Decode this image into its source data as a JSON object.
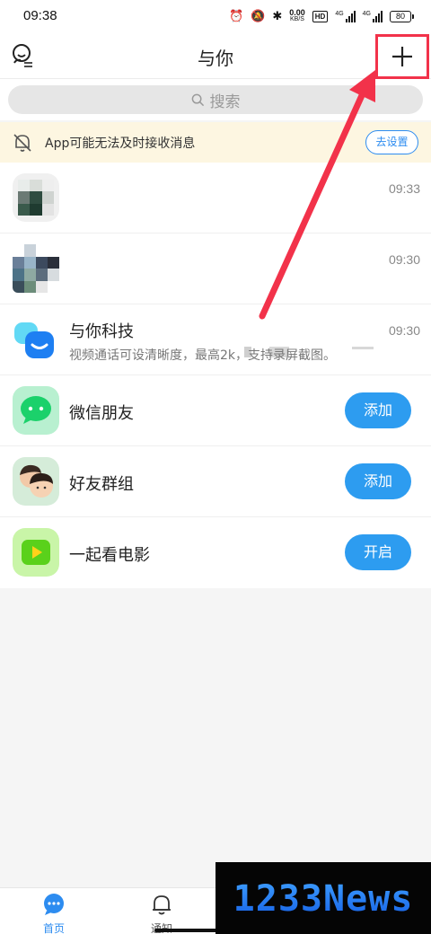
{
  "status_bar": {
    "time": "09:38",
    "speed_value": "0.00",
    "speed_unit": "KB/S",
    "hd_label": "HD",
    "network_1": "4G",
    "network_2": "4G",
    "battery": "80"
  },
  "header": {
    "title": "与你",
    "user_icon": "user-smile-icon",
    "add_icon": "plus-icon"
  },
  "search": {
    "placeholder": "搜索",
    "icon": "search-icon"
  },
  "notice": {
    "text": "App可能无法及时接收消息",
    "button": "去设置",
    "icon": "muted-bell-icon"
  },
  "conversations": [
    {
      "title": "",
      "subtitle": "",
      "time": "09:33",
      "avatar": "pixelated-avatar"
    },
    {
      "title": "",
      "subtitle": "",
      "time": "09:30",
      "avatar": "pixelated-avatar"
    },
    {
      "title": "与你科技",
      "subtitle": "视频通话可设清晰度，最高2k，支持录屏截图。",
      "time": "09:30",
      "avatar": "yuni-logo"
    }
  ],
  "features": [
    {
      "title": "微信朋友",
      "button": "添加",
      "icon": "wechat-chat-icon",
      "color": "#1bd16b"
    },
    {
      "title": "好友群组",
      "button": "添加",
      "icon": "group-faces-icon",
      "color": "#c8e6cd"
    },
    {
      "title": "一起看电影",
      "button": "开启",
      "icon": "play-video-icon",
      "color": "#9cf05a"
    }
  ],
  "nav": {
    "items": [
      {
        "label": "首页",
        "icon": "chat-bubble-icon",
        "active": true
      },
      {
        "label": "通知",
        "icon": "bell-icon",
        "active": false
      }
    ]
  },
  "watermark": "1233News",
  "colors": {
    "accent": "#2d8cf0",
    "button_blue": "#2d9cf0",
    "highlight_red": "#f2324a",
    "notice_bg": "#fdf6e1"
  }
}
